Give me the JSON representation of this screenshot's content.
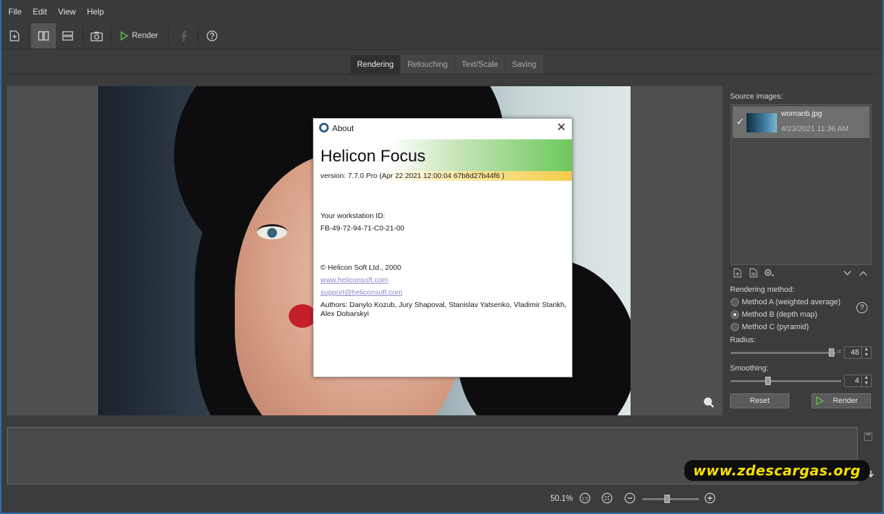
{
  "menu": [
    "File",
    "Edit",
    "View",
    "Help"
  ],
  "toolbar": {
    "render_label": "Render"
  },
  "tabs": [
    {
      "label": "Rendering",
      "active": true
    },
    {
      "label": "Retouching",
      "active": false
    },
    {
      "label": "Text/Scale",
      "active": false
    },
    {
      "label": "Saving",
      "active": false
    }
  ],
  "about": {
    "title": "About",
    "product": "Helicon Focus",
    "version": "version: 7.7.0 Pro (Apr 22 2021 12:00:04 67b8d27b44f6 )",
    "workstation_label": "Your workstation ID:",
    "workstation_id": "FB-49-72-94-71-C0-21-00",
    "copyright": "© Helicon Soft Ltd., 2000",
    "website": "www.heliconsoft.com",
    "email": "support@heliconsoft.com",
    "authors": "Authors: Danylo Kozub, Jury Shapoval, Stanislav Yatsenko, Vladimir Starikh, Alex Dobarskyi"
  },
  "right_panel": {
    "source_label": "Source images:",
    "source_item": {
      "name": "womanb.jpg",
      "date": "4/23/2021 11:36 AM"
    },
    "rendering_method_label": "Rendering method:",
    "methods": [
      {
        "label": "Method A (weighted average)",
        "selected": false
      },
      {
        "label": "Method B (depth map)",
        "selected": true
      },
      {
        "label": "Method C (pyramid)",
        "selected": false
      }
    ],
    "radius_label": "Radius:",
    "radius_value": "48",
    "smoothing_label": "Smoothing:",
    "smoothing_value": "4",
    "reset_label": "Reset",
    "render_label": "Render",
    "help": "?"
  },
  "status": {
    "zoom": "50.1%"
  },
  "watermark": "www.zdescargas.org",
  "colors": {
    "accent_green": "#5fbf45",
    "link": "#8a8acd",
    "watermark": "#f5e000"
  }
}
